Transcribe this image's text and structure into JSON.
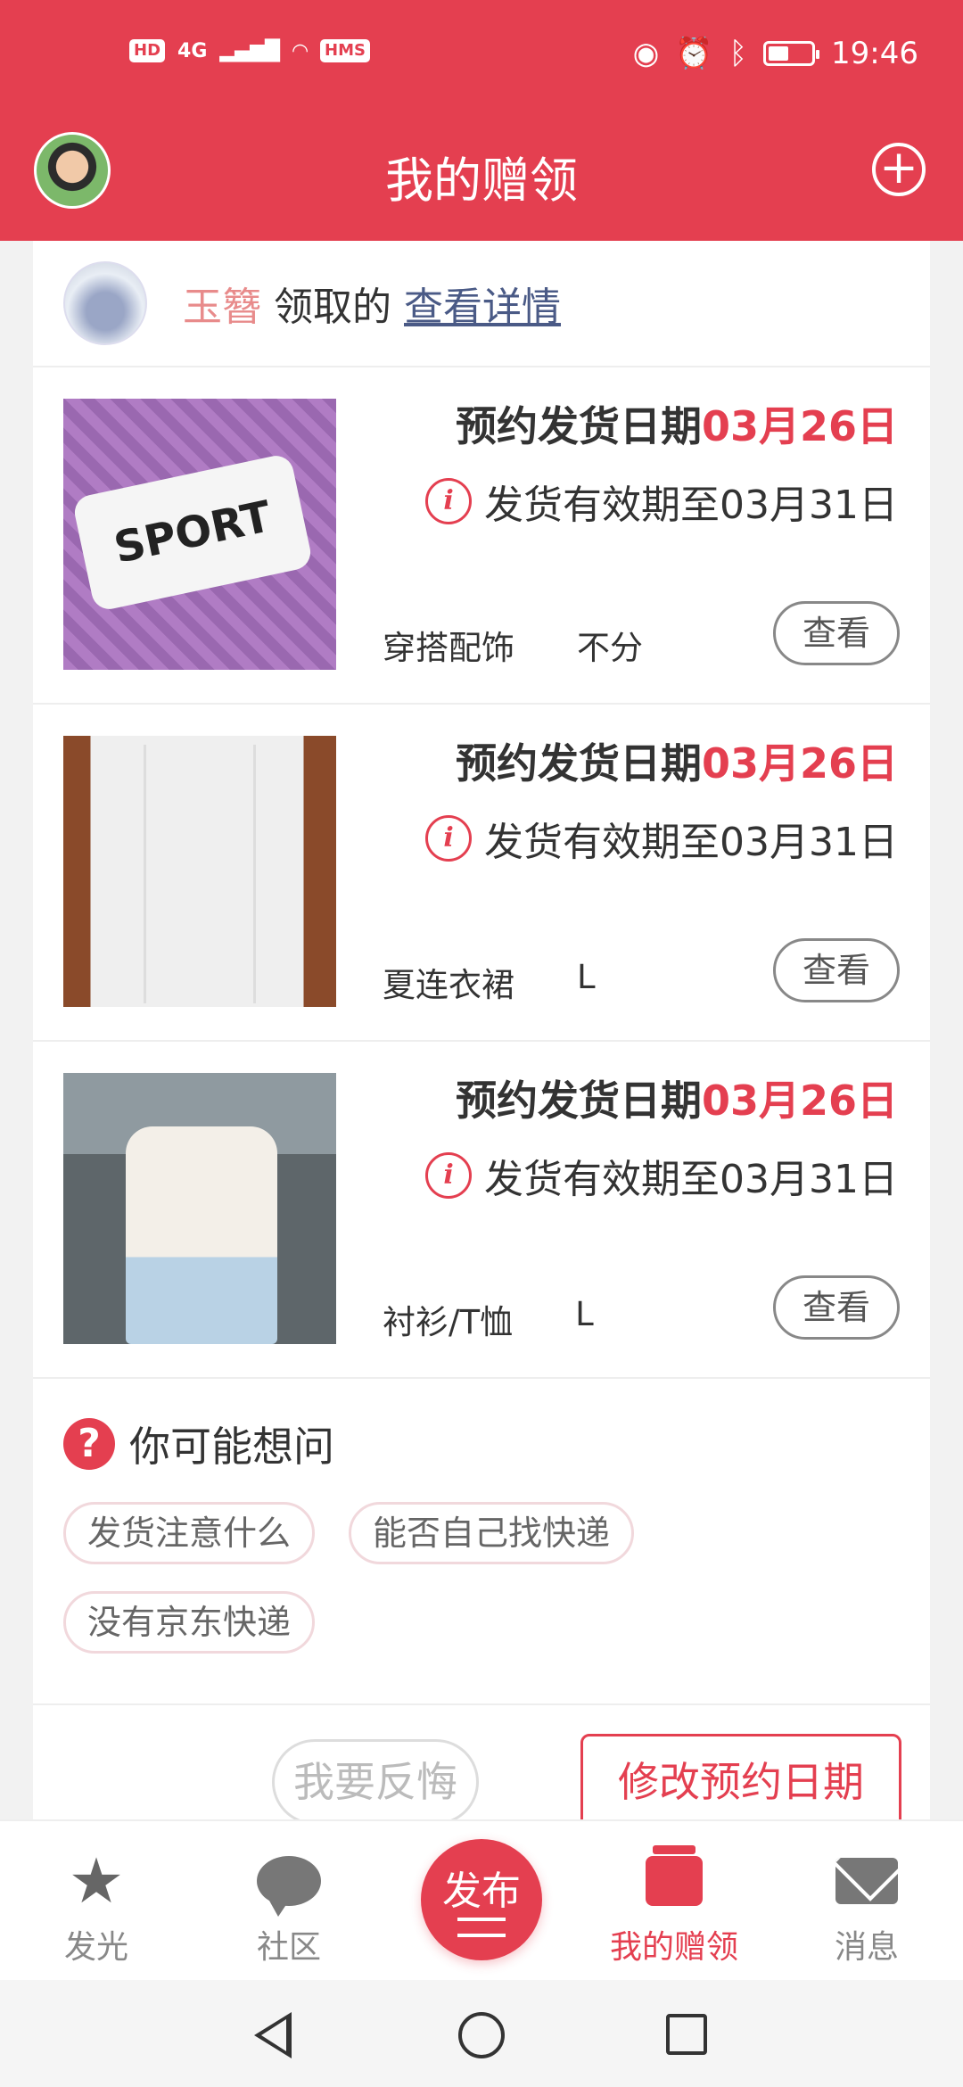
{
  "status_bar": {
    "network_badges": [
      "HD",
      "4G",
      "HMS"
    ],
    "time": "19:46"
  },
  "header": {
    "title": "我的赠领",
    "add_icon": "plus-circle-icon"
  },
  "receiver": {
    "name": "玉簪",
    "text": "领取的",
    "link": "查看详情"
  },
  "items": [
    {
      "ship_label": "预约发货日期",
      "ship_date": "03月26日",
      "validity": "发货有效期至03月31日",
      "category": "穿搭配饰",
      "size": "不分",
      "view_label": "查看"
    },
    {
      "ship_label": "预约发货日期",
      "ship_date": "03月26日",
      "validity": "发货有效期至03月31日",
      "category": "夏连衣裙",
      "size": "L",
      "view_label": "查看"
    },
    {
      "ship_label": "预约发货日期",
      "ship_date": "03月26日",
      "validity": "发货有效期至03月31日",
      "category": "衬衫/T恤",
      "size": "L",
      "view_label": "查看"
    }
  ],
  "faq": {
    "title": "你可能想问",
    "chips": [
      "发货注意什么",
      "能否自己找快递",
      "没有京东快递"
    ]
  },
  "actions": {
    "regret": "我要反悔",
    "modify": "修改预约日期"
  },
  "tabbar": {
    "tabs": [
      {
        "label": "发光",
        "icon": "star-icon"
      },
      {
        "label": "社区",
        "icon": "chat-bubble-icon"
      },
      {
        "label": "我的赠领",
        "icon": "gift-box-icon",
        "active": true
      },
      {
        "label": "消息",
        "icon": "mail-icon"
      }
    ],
    "publish": "发布"
  },
  "colors": {
    "accent": "#e43f50",
    "link": "#4a5a86",
    "receiver_name": "#e88b8b"
  }
}
